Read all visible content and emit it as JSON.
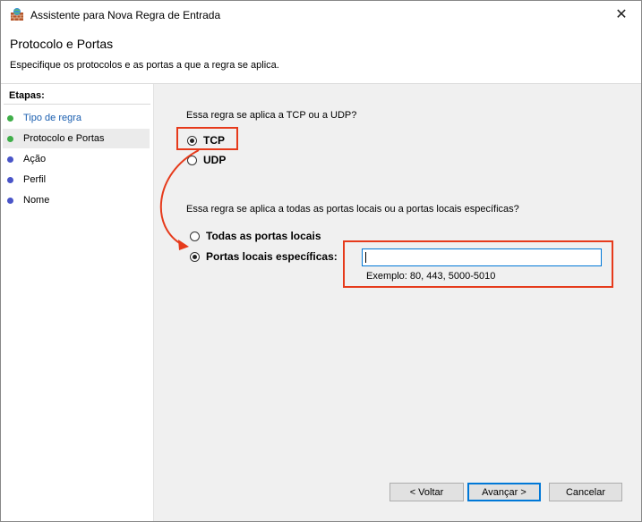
{
  "window": {
    "title": "Assistente para Nova Regra de Entrada",
    "close_symbol": "✕"
  },
  "header": {
    "title": "Protocolo e Portas",
    "subtitle": "Especifique os protocolos e as portas a que a regra se aplica."
  },
  "sidebar": {
    "heading": "Etapas:",
    "steps": [
      {
        "label": "Tipo de regra",
        "state": "done",
        "dot_color": "#3fae49"
      },
      {
        "label": "Protocolo e Portas",
        "state": "current",
        "dot_color": "#3fae49"
      },
      {
        "label": "Ação",
        "state": "pending",
        "dot_color": "#4a55c8"
      },
      {
        "label": "Perfil",
        "state": "pending",
        "dot_color": "#4a55c8"
      },
      {
        "label": "Nome",
        "state": "pending",
        "dot_color": "#4a55c8"
      }
    ]
  },
  "protocol": {
    "question": "Essa regra se aplica a TCP ou a UDP?",
    "options": [
      {
        "label": "TCP",
        "selected": true
      },
      {
        "label": "UDP",
        "selected": false
      }
    ]
  },
  "ports": {
    "question": "Essa regra se aplica a todas as portas locais ou a portas locais específicas?",
    "options": [
      {
        "label": "Todas as portas locais",
        "selected": false
      },
      {
        "label": "Portas locais específicas:",
        "selected": true
      }
    ],
    "input_value": "",
    "example": "Exemplo: 80, 443, 5000-5010"
  },
  "buttons": {
    "back": "< Voltar",
    "next": "Avançar >",
    "cancel": "Cancelar"
  },
  "colors": {
    "highlight": "#e63a1b",
    "accent": "#0078d7",
    "link": "#1b5fb0"
  }
}
